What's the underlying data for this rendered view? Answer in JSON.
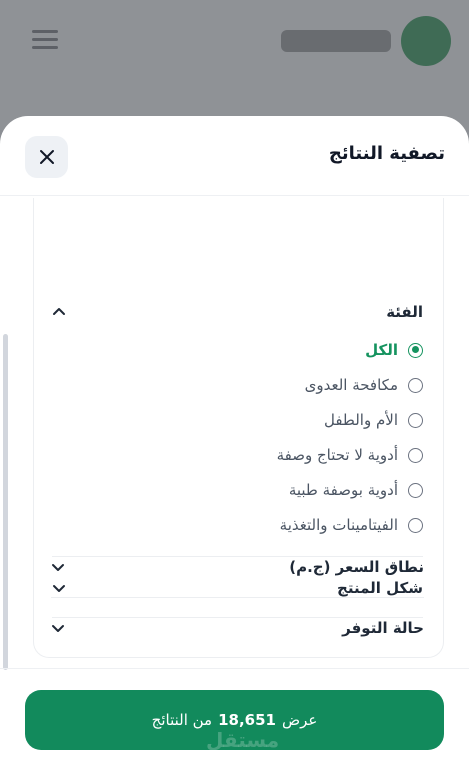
{
  "sheet": {
    "title": "تصفية النتائج"
  },
  "category": {
    "label": "الفئة",
    "expanded": true,
    "options": [
      {
        "label": "الكل",
        "selected": true
      },
      {
        "label": "مكافحة العدوى",
        "selected": false
      },
      {
        "label": "الأم والطفل",
        "selected": false
      },
      {
        "label": "أدوية لا تحتاج وصفة",
        "selected": false
      },
      {
        "label": "أدوية بوصفة طبية",
        "selected": false
      },
      {
        "label": "الفيتامينات والتغذية",
        "selected": false
      }
    ]
  },
  "sections": [
    {
      "label": "شكل المنتج",
      "expanded": false
    },
    {
      "label": "نطاق السعر (ج.م)",
      "expanded": false
    },
    {
      "label": "حالة التوفر",
      "expanded": false
    }
  ],
  "apply": {
    "prefix": "عرض",
    "count": "18,651",
    "suffix": "من النتائج"
  },
  "watermark": "مستقل",
  "colors": {
    "accent": "#15935f",
    "button": "#128a5c"
  },
  "icons": {
    "close": "close-icon",
    "collapse": "chevron-up-icon",
    "expand": "chevron-down-icon"
  }
}
